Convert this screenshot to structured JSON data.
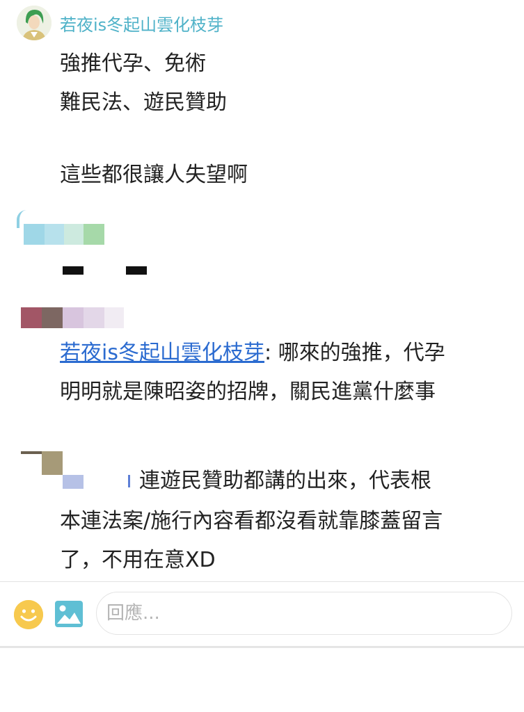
{
  "comments": [
    {
      "username": "若夜is冬起山雲化枝芽",
      "lines": [
        "強推代孕、免術",
        "難民法、遊民贊助",
        "",
        "這些都很讓人失望啊"
      ]
    },
    {
      "mention": "若夜is冬起山雲化枝芽",
      "mention_suffix": ": 哪來的強推，代孕",
      "line2": "明明就是陳昭姿的招牌，關民進黨什麼事"
    },
    {
      "line1": "連遊民贊助都講的出來，代表根",
      "line2": "本連法案/施行內容看都沒看就靠膝蓋留言",
      "line3": "了，不用在意XD"
    }
  ],
  "reply_bar": {
    "placeholder": "回應...",
    "emoji_icon": "smiley-icon",
    "image_icon": "image-icon"
  },
  "colors": {
    "username": "#4fb2c8",
    "mention_link": "#2b6bd0",
    "emoji": "#f7c94e",
    "image_icon": "#5fbfd4"
  }
}
